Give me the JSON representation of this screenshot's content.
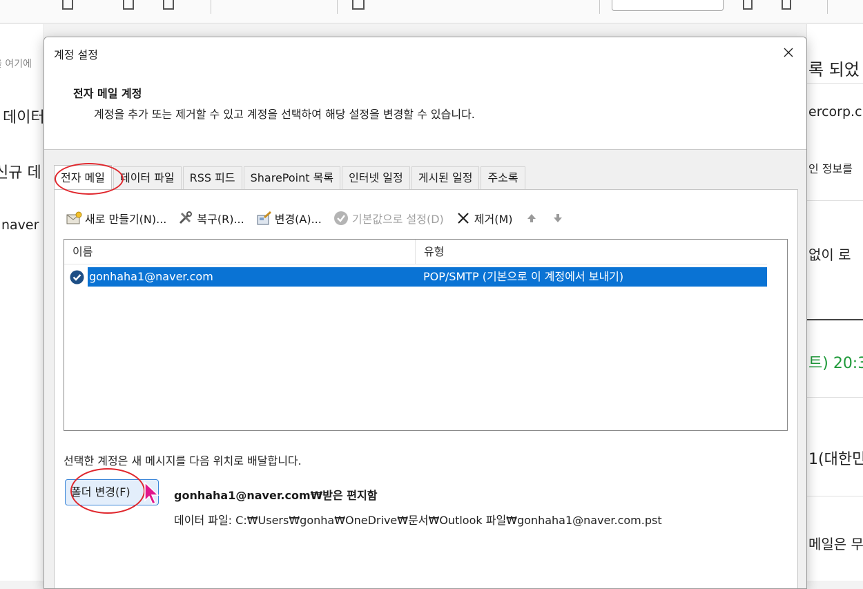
{
  "background": {
    "left_rows": [
      "을 여기에",
      "데이터",
      "신규 데",
      "naver"
    ],
    "right_rows": [
      "록 되었",
      "ercorp.c",
      "인 정보를",
      "없이 로",
      "트) 20:3",
      "1(대한민",
      "메일은 무"
    ]
  },
  "dialog": {
    "title": "계정 설정",
    "header_title": "전자 메일 계정",
    "header_desc": "계정을 추가 또는 제거할 수 있고 계정을 선택하여 해당 설정을 변경할 수 있습니다.",
    "tabs": [
      {
        "label": "전자 메일"
      },
      {
        "label": "데이터 파일"
      },
      {
        "label": "RSS 피드"
      },
      {
        "label": "SharePoint 목록"
      },
      {
        "label": "인터넷 일정"
      },
      {
        "label": "게시된 일정"
      },
      {
        "label": "주소록"
      }
    ],
    "toolbar": {
      "new": "새로 만들기(N)...",
      "repair": "복구(R)...",
      "change": "변경(A)...",
      "set_default": "기본값으로 설정(D)",
      "remove": "제거(M)"
    },
    "list": {
      "col_name": "이름",
      "col_type": "유형",
      "rows": [
        {
          "name": "gonhaha1@naver.com",
          "type": "POP/SMTP (기본으로 이 계정에서 보내기)"
        }
      ]
    },
    "deliver_label": "선택한 계정은 새 메시지를 다음 위치로 배달합니다.",
    "folder_button": "폴더 변경(F)",
    "folder_path": "gonhaha1@naver.com₩받은 편지함",
    "data_file": "데이터 파일: C:₩Users₩gonha₩OneDrive₩문서₩Outlook 파일₩gonhaha1@naver.com.pst"
  },
  "colors": {
    "selection": "#0a73d4",
    "highlight_circle": "#e0282e",
    "cursor": "#e0188c",
    "green_text": "#1f9a3a"
  }
}
